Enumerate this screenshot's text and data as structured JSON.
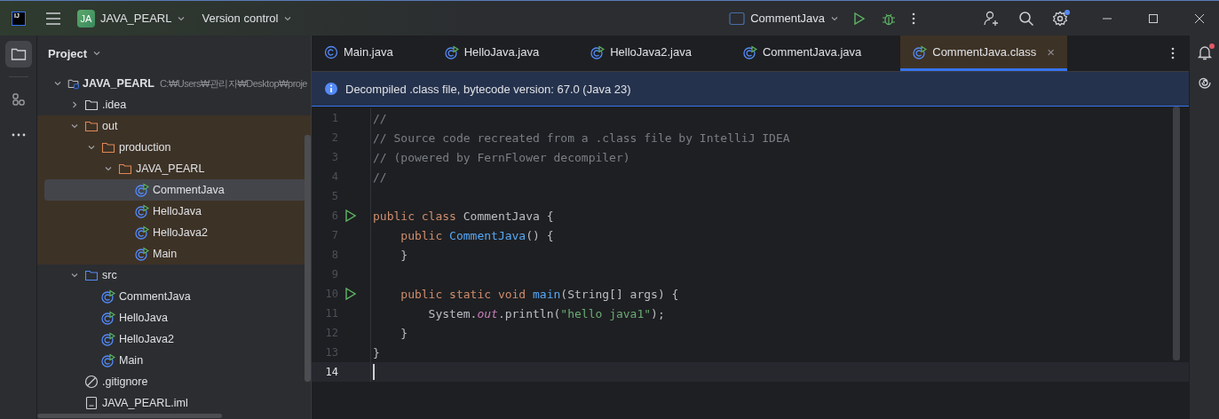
{
  "title_bar": {
    "logo": "IJ",
    "project": {
      "badge": "JA",
      "name": "JAVA_PEARL"
    },
    "vcs": "Version control",
    "run_config": "CommentJava",
    "settings_badge": true
  },
  "project_panel": {
    "title": "Project",
    "tree": [
      {
        "label": "JAVA_PEARL",
        "path": "C:₩Users₩관리자₩Desktop₩proje",
        "kind": "module",
        "expanded": true,
        "selected": false,
        "excluded": false,
        "children": [
          {
            "label": ".idea",
            "kind": "folder",
            "expanded": false,
            "selected": false,
            "excluded": false
          },
          {
            "label": "out",
            "kind": "excluded-folder",
            "expanded": true,
            "selected": false,
            "excluded": true,
            "children": [
              {
                "label": "production",
                "kind": "excluded-folder",
                "expanded": true,
                "selected": false,
                "excluded": true,
                "children": [
                  {
                    "label": "JAVA_PEARL",
                    "kind": "excluded-folder",
                    "expanded": true,
                    "selected": false,
                    "excluded": true,
                    "children": [
                      {
                        "label": "CommentJava",
                        "kind": "class",
                        "selected": true,
                        "excluded": true
                      },
                      {
                        "label": "HelloJava",
                        "kind": "class",
                        "selected": false,
                        "excluded": true
                      },
                      {
                        "label": "HelloJava2",
                        "kind": "class",
                        "selected": false,
                        "excluded": true
                      },
                      {
                        "label": "Main",
                        "kind": "class",
                        "selected": false,
                        "excluded": true
                      }
                    ]
                  }
                ]
              }
            ]
          },
          {
            "label": "src",
            "kind": "source-folder",
            "expanded": true,
            "selected": false,
            "excluded": false,
            "children": [
              {
                "label": "CommentJava",
                "kind": "class",
                "selected": false,
                "excluded": false
              },
              {
                "label": "HelloJava",
                "kind": "class",
                "selected": false,
                "excluded": false
              },
              {
                "label": "HelloJava2",
                "kind": "class",
                "selected": false,
                "excluded": false
              },
              {
                "label": "Main",
                "kind": "class",
                "selected": false,
                "excluded": false
              }
            ]
          },
          {
            "label": ".gitignore",
            "kind": "ignore-file",
            "selected": false,
            "excluded": false
          },
          {
            "label": "JAVA_PEARL.iml",
            "kind": "module-file",
            "selected": false,
            "excluded": false
          }
        ]
      }
    ]
  },
  "editor": {
    "tabs": [
      {
        "label": "Main.java",
        "kind": "class",
        "selected": false
      },
      {
        "label": "HelloJava.java",
        "kind": "runnable-class",
        "selected": false
      },
      {
        "label": "HelloJava2.java",
        "kind": "runnable-class",
        "selected": false
      },
      {
        "label": "CommentJava.java",
        "kind": "runnable-class",
        "selected": false
      },
      {
        "label": "CommentJava.class",
        "kind": "runnable-class",
        "selected": true,
        "close": "×"
      }
    ],
    "banner": "Decompiled .class file, bytecode version: 67.0 (Java 23)",
    "lines": [
      {
        "number": "1",
        "runnable": false,
        "current": false,
        "tokens": [
          {
            "kind": "comment",
            "text": "//"
          }
        ]
      },
      {
        "number": "2",
        "runnable": false,
        "current": false,
        "tokens": [
          {
            "kind": "comment",
            "text": "// Source code recreated from a .class file by IntelliJ IDEA"
          }
        ]
      },
      {
        "number": "3",
        "runnable": false,
        "current": false,
        "tokens": [
          {
            "kind": "comment",
            "text": "// (powered by FernFlower decompiler)"
          }
        ]
      },
      {
        "number": "4",
        "runnable": false,
        "current": false,
        "tokens": [
          {
            "kind": "comment",
            "text": "//"
          }
        ]
      },
      {
        "number": "5",
        "runnable": false,
        "current": false
      },
      {
        "number": "6",
        "runnable": true,
        "current": false,
        "tokens": [
          {
            "kind": "keyword",
            "text": "public class "
          },
          {
            "kind": "plain",
            "text": "CommentJava {"
          }
        ]
      },
      {
        "number": "7",
        "runnable": false,
        "current": false,
        "tokens": [
          {
            "kind": "keyword",
            "text": "    public "
          },
          {
            "kind": "function",
            "text": "CommentJava"
          },
          {
            "kind": "plain",
            "text": "() {"
          }
        ]
      },
      {
        "number": "8",
        "runnable": false,
        "current": false,
        "tokens": [
          {
            "kind": "plain",
            "text": "    }"
          }
        ]
      },
      {
        "number": "9",
        "runnable": false,
        "current": false
      },
      {
        "number": "10",
        "runnable": true,
        "current": false,
        "tokens": [
          {
            "kind": "keyword",
            "text": "    public static void "
          },
          {
            "kind": "function",
            "text": "main"
          },
          {
            "kind": "plain",
            "text": "(String[] args) {"
          }
        ]
      },
      {
        "number": "11",
        "runnable": false,
        "current": false,
        "tokens": [
          {
            "kind": "plain",
            "text": "        System."
          },
          {
            "kind": "static-field",
            "text": "out"
          },
          {
            "kind": "plain",
            "text": ".println("
          },
          {
            "kind": "string",
            "text": "\"hello java1\""
          },
          {
            "kind": "plain",
            "text": ");"
          }
        ]
      },
      {
        "number": "12",
        "runnable": false,
        "current": false,
        "tokens": [
          {
            "kind": "plain",
            "text": "    }"
          }
        ]
      },
      {
        "number": "13",
        "runnable": false,
        "current": false,
        "tokens": [
          {
            "kind": "plain",
            "text": "}"
          }
        ]
      },
      {
        "number": "14",
        "runnable": false,
        "current": true
      }
    ]
  },
  "right_strip": {
    "notifications_badge": true
  }
}
